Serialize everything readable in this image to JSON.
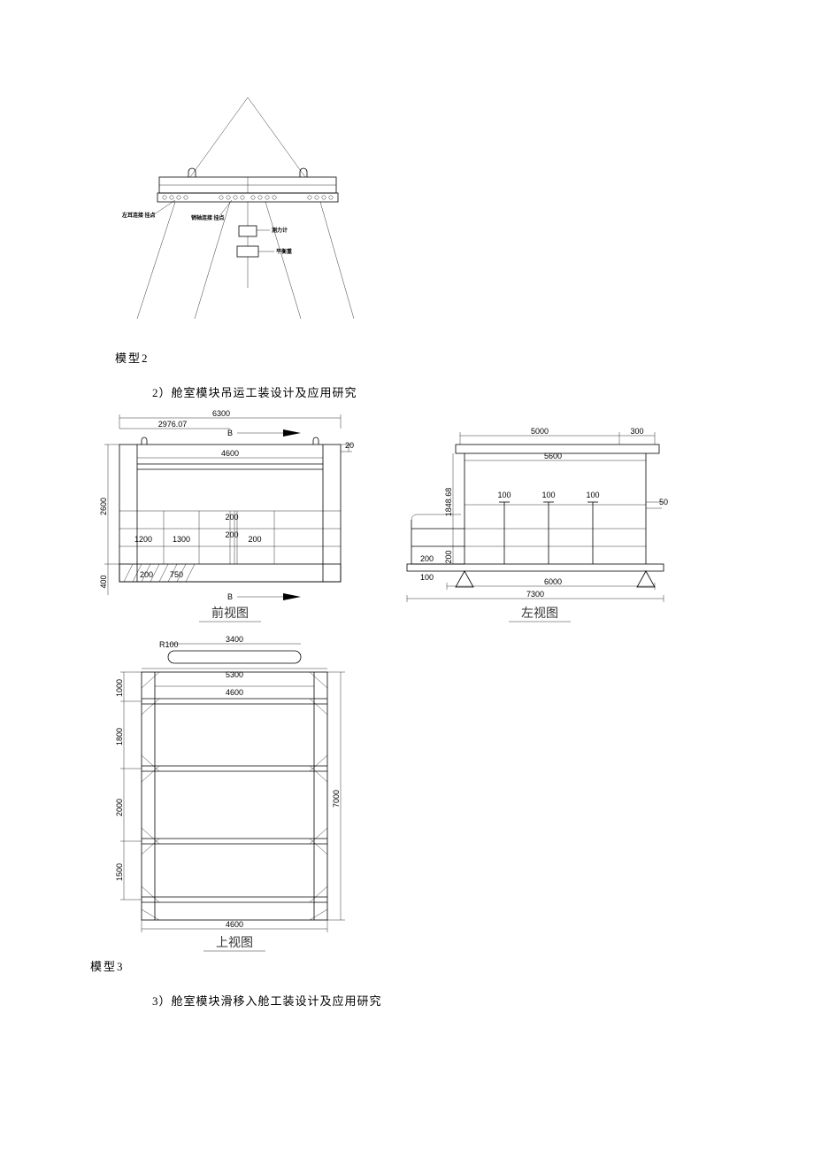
{
  "model2": {
    "caption": "模型2",
    "labels": {
      "left_label": "左耳连接\n挂点",
      "mid_label": "销轴连接\n挂点",
      "right_label_1": "测力计",
      "right_label_2": "平衡重"
    }
  },
  "heading2": "2）舱室模块吊运工装设计及应用研究",
  "model3": {
    "caption": "模型3",
    "front": {
      "view_label": "前视图",
      "section_letter_top": "B",
      "section_letter_bottom": "B",
      "dims": {
        "total_w": "6300",
        "inner_w": "2976.07",
        "crossbar": "4600",
        "height": "2600",
        "bottom_offset": "400",
        "left_seg1": "1200",
        "left_seg2": "1300",
        "small1": "200",
        "small2": "200",
        "small3": "200",
        "right_side": "20",
        "bot_left_small": "200",
        "bot_seg": "750"
      }
    },
    "left": {
      "view_label": "左视图",
      "dims": {
        "top_span": "5000",
        "top_right": "300",
        "beam": "5600",
        "base_inner": "6000",
        "base_total": "7300",
        "vspan1": "100",
        "vspan2": "100",
        "vspan3": "100",
        "height_upper": "1848.68",
        "height_lower": "200",
        "bot_small": "200",
        "side_small": "100",
        "side_small2": "50"
      }
    },
    "top": {
      "view_label": "上视图",
      "dims": {
        "radius": "R100",
        "inner_top": "3400",
        "outer_w": "5300",
        "beam": "4600",
        "side1": "1000",
        "side2": "1800",
        "side3": "2000",
        "side4": "1500",
        "total_h": "7000",
        "bottom_w": "4600"
      }
    }
  },
  "heading3": "3）舱室模块滑移入舱工装设计及应用研究"
}
